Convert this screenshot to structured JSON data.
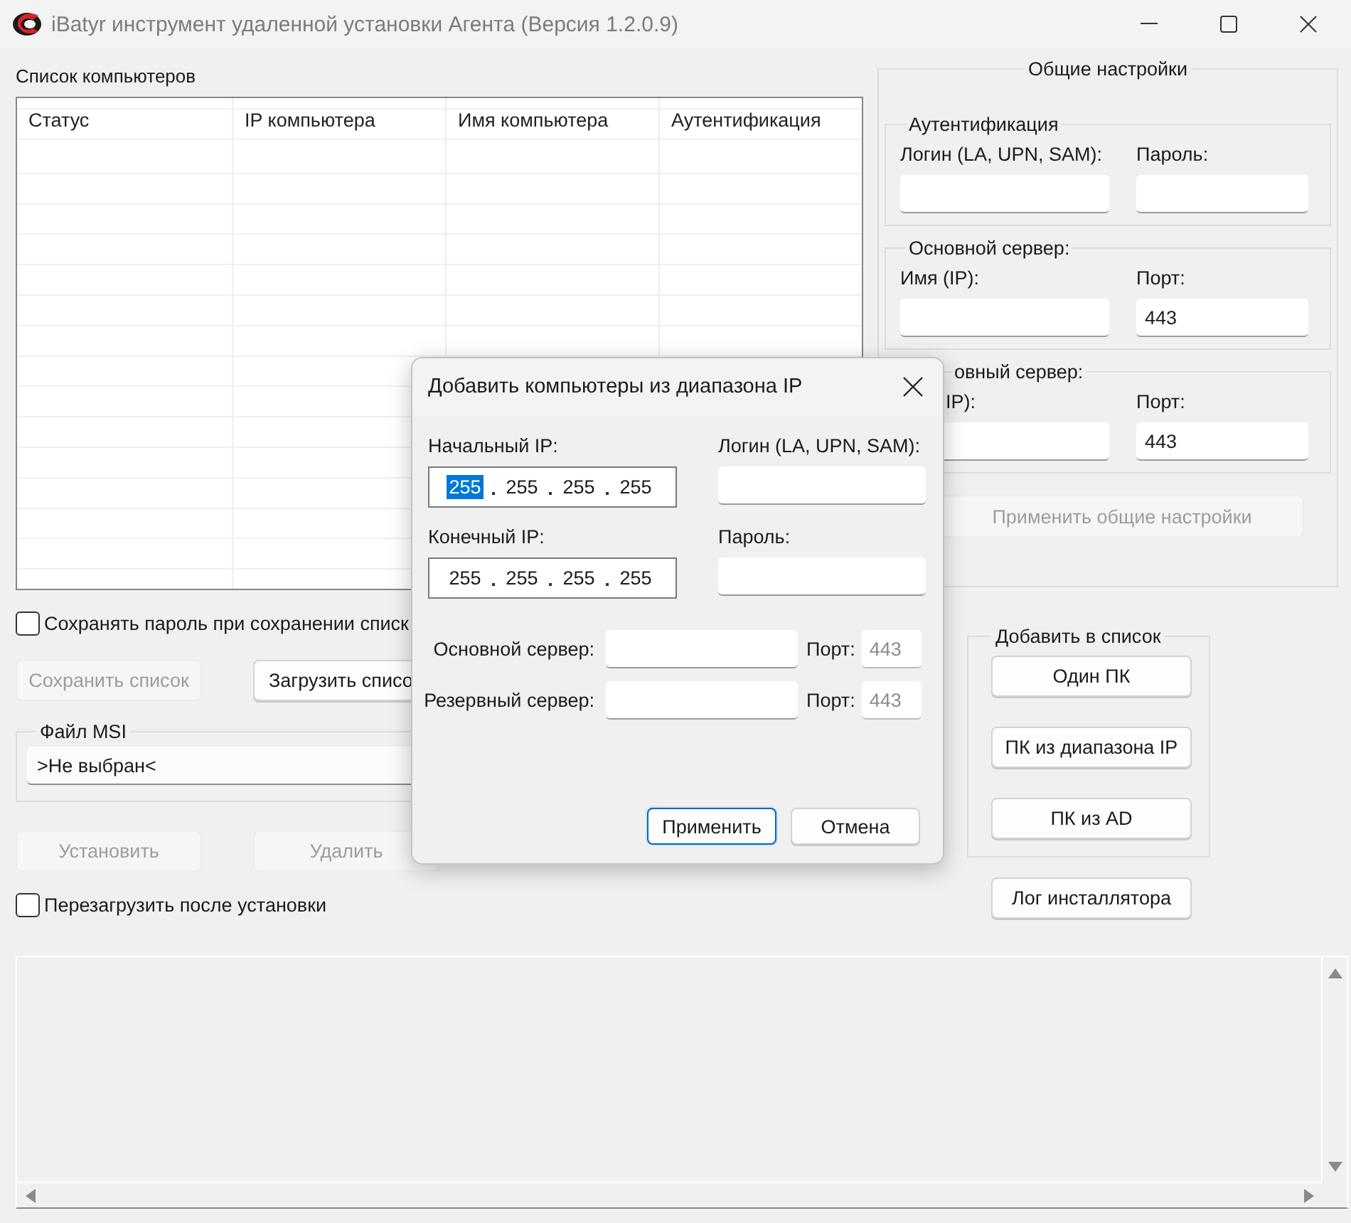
{
  "window": {
    "title": "iBatyr инструмент удаленной установки Агента (Версия 1.2.0.9)"
  },
  "computer_list": {
    "label": "Список компьютеров",
    "columns": [
      "Статус",
      "IP компьютера",
      "Имя компьютера",
      "Аутентификация"
    ]
  },
  "save_password": {
    "label": "Сохранять пароль при сохранении списк",
    "checked": false
  },
  "list_buttons": [
    {
      "label": "Сохранить список",
      "disabled": true
    },
    {
      "label": "Загрузить списо",
      "disabled": false
    }
  ],
  "msi_file": {
    "label": "Файл MSI",
    "value": ">Не выбран<"
  },
  "action_buttons": [
    {
      "label": "Установить",
      "disabled": true
    },
    {
      "label": "Удалить",
      "disabled": true
    }
  ],
  "reboot_after_install": {
    "label": "Перезагрузить после установки",
    "checked": false
  },
  "general_settings": {
    "title": "Общие настройки",
    "groups": [
      {
        "title": "Аутентификация",
        "fields": [
          {
            "label": "Логин (LA, UPN, SAM):"
          },
          {
            "label": "Пароль:"
          }
        ]
      },
      {
        "title": "Основной сервер:",
        "fields": [
          {
            "label": "Имя (IP):"
          },
          {
            "label": "Порт:",
            "value": "443"
          }
        ]
      },
      {
        "title": "овный сервер:",
        "fields": [
          {
            "label": "IP):"
          },
          {
            "label": "Порт:",
            "value": "443"
          }
        ]
      }
    ],
    "apply_button": {
      "label": "Применить общие настройки",
      "disabled": true
    }
  },
  "add_to_list": {
    "title": "Добавить в список",
    "buttons": [
      "Один ПК",
      "ПК из диапазона IP",
      "ПК из AD"
    ]
  },
  "installer_log_button": "Лог инсталлятора",
  "dialog": {
    "title": "Добавить компьютеры из диапазона IP",
    "start_ip": {
      "label": "Начальный IP:",
      "octets": [
        {
          "value": "255",
          "selected": true
        },
        {
          "value": "255",
          "selected": false
        },
        {
          "value": "255",
          "selected": false
        },
        {
          "value": "255",
          "selected": false
        }
      ]
    },
    "end_ip": {
      "label": "Конечный IP:",
      "octets": [
        {
          "value": "255",
          "selected": false
        },
        {
          "value": "255",
          "selected": false
        },
        {
          "value": "255",
          "selected": false
        },
        {
          "value": "255",
          "selected": false
        }
      ]
    },
    "login": {
      "label": "Логин (LA, UPN, SAM):"
    },
    "password": {
      "label": "Пароль:"
    },
    "servers": [
      {
        "label": "Основной сервер:",
        "port_label": "Порт:",
        "port_placeholder": "443"
      },
      {
        "label": "Резервный сервер:",
        "port_label": "Порт:",
        "port_placeholder": "443"
      }
    ],
    "buttons": [
      {
        "label": "Применить",
        "default": true
      },
      {
        "label": "Отмена",
        "default": false
      }
    ]
  }
}
